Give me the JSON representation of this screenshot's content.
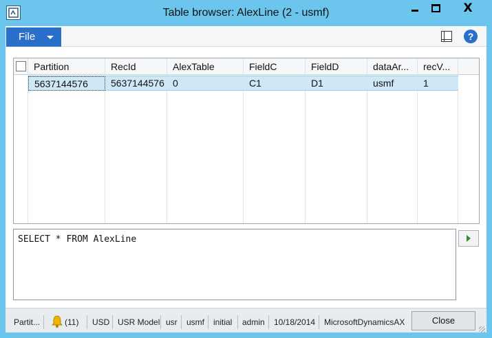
{
  "window": {
    "title": "Table browser: AlexLine (2 - usmf)",
    "minimize_glyph": "",
    "close_glyph": "X"
  },
  "menubar": {
    "file_label": "File"
  },
  "grid": {
    "columns": [
      "Partition",
      "RecId",
      "AlexTable",
      "FieldC",
      "FieldD",
      "dataAr...",
      "recV..."
    ],
    "rows": [
      [
        "5637144576",
        "5637144576",
        "0",
        "C1",
        "D1",
        "usmf",
        "1"
      ]
    ]
  },
  "query": {
    "text": "SELECT * FROM AlexLine"
  },
  "statusbar": {
    "partition": "Partit...",
    "notifications": "(11)",
    "currency": "USD",
    "model": "USR Model",
    "layer": "usr",
    "company": "usmf",
    "state": "initial",
    "user": "admin",
    "date": "10/18/2014",
    "server": "MicrosoftDynamicsAX",
    "close_label": "Close"
  },
  "colors": {
    "title_bg": "#6cc5ec",
    "file_btn": "#2a6fc9",
    "selected_row": "#cfe8f8"
  }
}
